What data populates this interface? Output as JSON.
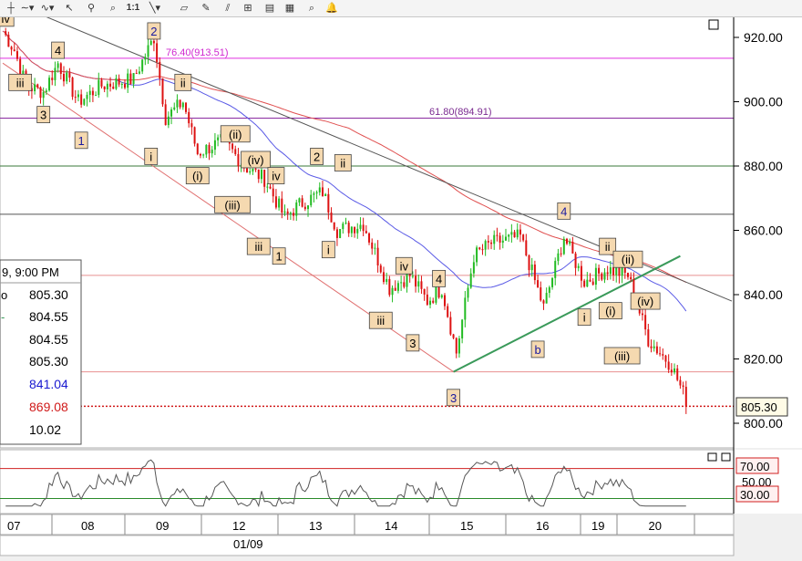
{
  "toolbar": {
    "icons": [
      "crosshair-icon",
      "indicator-icon",
      "drawing-tools-icon",
      "pointer-icon",
      "zoom-icon",
      "one-to-one-icon",
      "trendline-icon",
      "eraser-icon",
      "pencil-icon",
      "fibonacci-icon",
      "properties-icon",
      "layers-icon",
      "find-icon",
      "alert-icon"
    ],
    "zoom_label": "1:1"
  },
  "chart_data": {
    "type": "candlestick",
    "price_axis": {
      "ticks": [
        "920.00",
        "900.00",
        "880.00",
        "860.00",
        "840.00",
        "820.00",
        "800.00"
      ],
      "ylim": [
        790,
        925
      ]
    },
    "time_axis": {
      "labels": [
        "07",
        "08",
        "09",
        "12",
        "13",
        "14",
        "15",
        "16",
        "19",
        "20"
      ],
      "month_label": "01/09"
    },
    "last_price": "805.30",
    "fib_levels": [
      {
        "label": "76.40(913.51)",
        "value": 913.51,
        "color": "#e030e0"
      },
      {
        "label": "61.80(894.91)",
        "value": 894.91,
        "color": "#8a2aa0"
      }
    ],
    "horizontal_lines": [
      {
        "value": 880,
        "color": "#3a7a3a"
      },
      {
        "value": 865,
        "color": "#555555"
      },
      {
        "value": 846,
        "color": "#e89090"
      },
      {
        "value": 816,
        "color": "#e89090"
      }
    ],
    "waves": [
      {
        "text": "iv",
        "bar": 1,
        "price": 926,
        "color": "#000"
      },
      {
        "text": "4",
        "bar": 19,
        "price": 916,
        "color": "#000"
      },
      {
        "text": "2",
        "bar": 52,
        "price": 922,
        "color": "#1a1aa0"
      },
      {
        "text": "iii",
        "bar": 6,
        "price": 906,
        "color": "#000"
      },
      {
        "text": "ii",
        "bar": 62,
        "price": 906,
        "color": "#000"
      },
      {
        "text": "3",
        "bar": 14,
        "price": 896,
        "color": "#000"
      },
      {
        "text": "1",
        "bar": 27,
        "price": 888,
        "color": "#1a1aa0"
      },
      {
        "text": "(ii)",
        "bar": 80,
        "price": 890,
        "color": "#000"
      },
      {
        "text": "i",
        "bar": 51,
        "price": 883,
        "color": "#000"
      },
      {
        "text": "(iv)",
        "bar": 87,
        "price": 882,
        "color": "#000"
      },
      {
        "text": "(i)",
        "bar": 67,
        "price": 877,
        "color": "#000"
      },
      {
        "text": "iv",
        "bar": 94,
        "price": 877,
        "color": "#000"
      },
      {
        "text": "2",
        "bar": 108,
        "price": 883,
        "color": "#000"
      },
      {
        "text": "ii",
        "bar": 117,
        "price": 881,
        "color": "#000"
      },
      {
        "text": "(iii)",
        "bar": 79,
        "price": 868,
        "color": "#000"
      },
      {
        "text": "iii",
        "bar": 88,
        "price": 855,
        "color": "#000"
      },
      {
        "text": "1",
        "bar": 95,
        "price": 852,
        "color": "#000"
      },
      {
        "text": "i",
        "bar": 112,
        "price": 854,
        "color": "#000"
      },
      {
        "text": "iv",
        "bar": 138,
        "price": 849,
        "color": "#000"
      },
      {
        "text": "4",
        "bar": 150,
        "price": 845,
        "color": "#000"
      },
      {
        "text": "iii",
        "bar": 130,
        "price": 832,
        "color": "#000"
      },
      {
        "text": "3",
        "bar": 141,
        "price": 825,
        "color": "#000"
      },
      {
        "text": "3",
        "bar": 155,
        "price": 808,
        "color": "#1a1aa0"
      },
      {
        "text": "4",
        "bar": 193,
        "price": 866,
        "color": "#1a1aa0"
      },
      {
        "text": "ii",
        "bar": 208,
        "price": 855,
        "color": "#000"
      },
      {
        "text": "(ii)",
        "bar": 215,
        "price": 851,
        "color": "#000"
      },
      {
        "text": "b",
        "bar": 184,
        "price": 823,
        "color": "#1a1aa0"
      },
      {
        "text": "i",
        "bar": 200,
        "price": 833,
        "color": "#000"
      },
      {
        "text": "(i)",
        "bar": 209,
        "price": 835,
        "color": "#000"
      },
      {
        "text": "(iv)",
        "bar": 221,
        "price": 838,
        "color": "#000"
      },
      {
        "text": "(iii)",
        "bar": 213,
        "price": 821,
        "color": "#000"
      }
    ],
    "rsi": {
      "levels": [
        "70.00",
        "30.00"
      ],
      "partial_label": "50.00"
    },
    "info_panel": {
      "time": "9, 9:00 PM",
      "rows": [
        {
          "key": "o",
          "value": "805.30",
          "color": "#000"
        },
        {
          "key": "-",
          "value": "804.55",
          "color": "#000"
        },
        {
          "key": "",
          "value": "804.55",
          "color": "#000"
        },
        {
          "key": "",
          "value": "805.30",
          "color": "#000"
        },
        {
          "key": "",
          "value": "841.04",
          "color": "#1a1ad0"
        },
        {
          "key": "",
          "value": "869.08",
          "color": "#d01a1a"
        },
        {
          "key": "",
          "value": "10.02",
          "color": "#000"
        }
      ]
    },
    "colors": {
      "up": "#22bb22",
      "down": "#dd1111",
      "ma_fast": "#5a5ae6",
      "ma_slow": "#e05050",
      "trendline": "#3a9a5a",
      "channel": "#555555"
    }
  }
}
